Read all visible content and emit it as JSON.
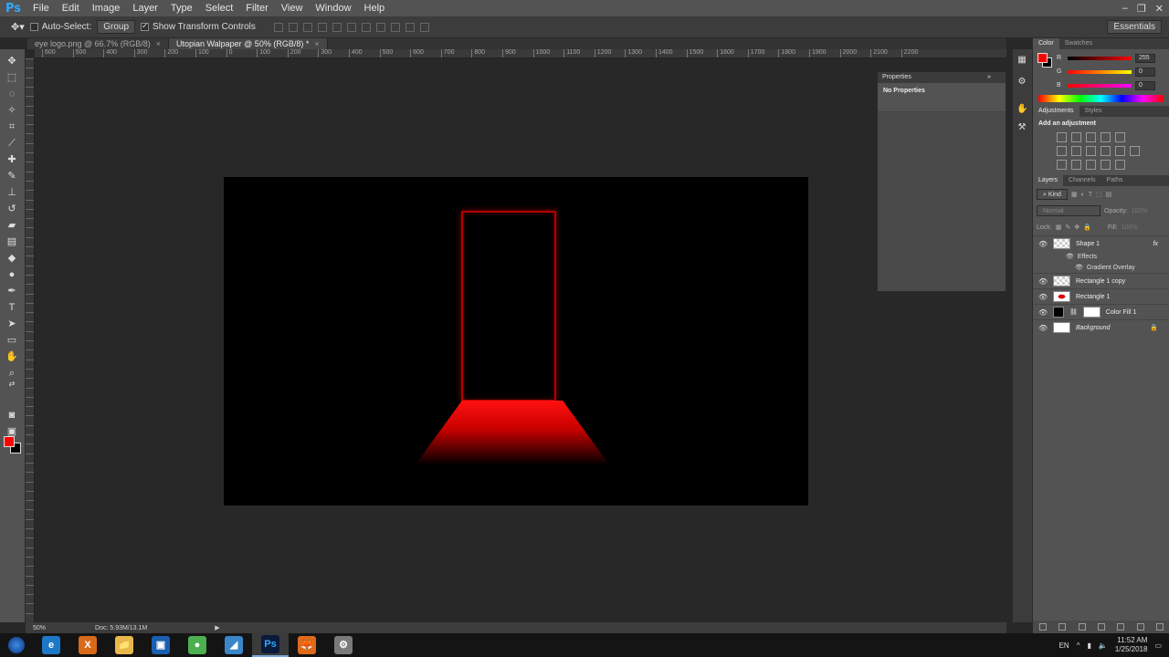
{
  "app": {
    "logo": "Ps"
  },
  "menu": [
    "File",
    "Edit",
    "Image",
    "Layer",
    "Type",
    "Select",
    "Filter",
    "View",
    "Window",
    "Help"
  ],
  "window_controls": [
    "–",
    "❐",
    "✕"
  ],
  "options": {
    "auto_select_label": "Auto-Select:",
    "group_value": "Group",
    "transform_controls_label": "Show Transform Controls",
    "workspace": "Essentials"
  },
  "tabs": [
    {
      "label": "eye logo.png @ 66.7% (RGB/8)",
      "active": false
    },
    {
      "label": "Utopian Walpaper @ 50% (RGB/8) *",
      "active": true
    }
  ],
  "ruler_labels": [
    "600",
    "500",
    "400",
    "300",
    "200",
    "100",
    "0",
    "100",
    "200",
    "300",
    "400",
    "500",
    "600",
    "700",
    "800",
    "900",
    "1000",
    "1100",
    "1200",
    "1300",
    "1400",
    "1500",
    "1600",
    "1700",
    "1800",
    "1900",
    "2000",
    "2100",
    "2200"
  ],
  "status": {
    "zoom": "50%",
    "doc": "Doc: 5.93M/13.1M"
  },
  "properties": {
    "title": "Properties",
    "body": "No Properties"
  },
  "color_panel": {
    "tabs": [
      "Color",
      "Swatches"
    ],
    "channels": [
      {
        "label": "R",
        "value": "255",
        "gradient": "linear-gradient(to right, #000, #f00)"
      },
      {
        "label": "G",
        "value": "0",
        "gradient": "linear-gradient(to right, #f00, #ff0)"
      },
      {
        "label": "B",
        "value": "0",
        "gradient": "linear-gradient(to right, #f00, #f0f)"
      }
    ],
    "foreground": "#ff0000",
    "background": "#000000"
  },
  "adjustments": {
    "tabs": [
      "Adjustments",
      "Styles"
    ],
    "title": "Add an adjustment"
  },
  "layers_panel": {
    "tabs": [
      "Layers",
      "Channels",
      "Paths"
    ],
    "kind_label": "Kind",
    "blend_mode": "Normal",
    "opacity_label": "Opacity:",
    "opacity_value": "100%",
    "lock_label": "Lock:",
    "fill_label": "Fill:",
    "fill_value": "100%",
    "layers": [
      {
        "name": "Shape 1",
        "fx": "fx",
        "effects": "Effects",
        "effect_item": "Gradient Overlay",
        "thumb": "checker"
      },
      {
        "name": "Rectangle 1 copy",
        "thumb": "checker"
      },
      {
        "name": "Rectangle 1",
        "thumb": "red"
      },
      {
        "name": "Color Fill 1",
        "thumb": "black"
      },
      {
        "name": "Background",
        "thumb": "white",
        "locked": true
      }
    ]
  },
  "taskbar": {
    "apps": [
      "e",
      "X",
      "📁",
      "▣",
      "●",
      "◢",
      "Ps",
      "🦊",
      "⚙"
    ],
    "lang": "EN",
    "time": "11:52 AM",
    "date": "1/25/2018"
  }
}
